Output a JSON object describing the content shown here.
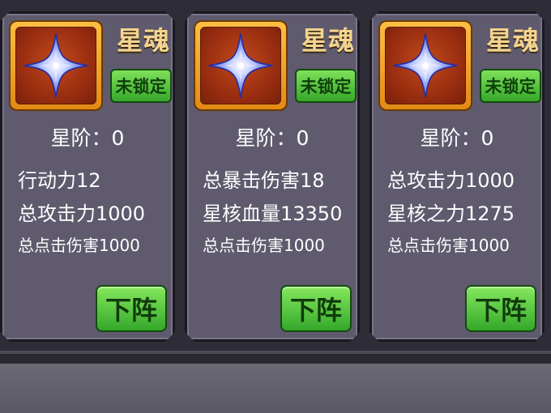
{
  "cards": [
    {
      "title": "星魂",
      "lock_label": "未锁定",
      "rank": "星阶：0",
      "stats": [
        "行动力12",
        "总攻击力1000",
        "总点击伤害1000"
      ],
      "button_label": "下阵"
    },
    {
      "title": "星魂",
      "lock_label": "未锁定",
      "rank": "星阶：0",
      "stats": [
        "总暴击伤害18",
        "星核血量13350",
        "总点击伤害1000"
      ],
      "button_label": "下阵"
    },
    {
      "title": "星魂",
      "lock_label": "未锁定",
      "rank": "星阶：0",
      "stats": [
        "总攻击力1000",
        "星核之力1275",
        "总点击伤害1000"
      ],
      "button_label": "下阵"
    }
  ],
  "icons": {
    "item_icon": "four-point-star-icon"
  },
  "colors": {
    "title": "#f4d48e",
    "button_green": "#34a82a",
    "frame_orange": "#e28a14"
  }
}
